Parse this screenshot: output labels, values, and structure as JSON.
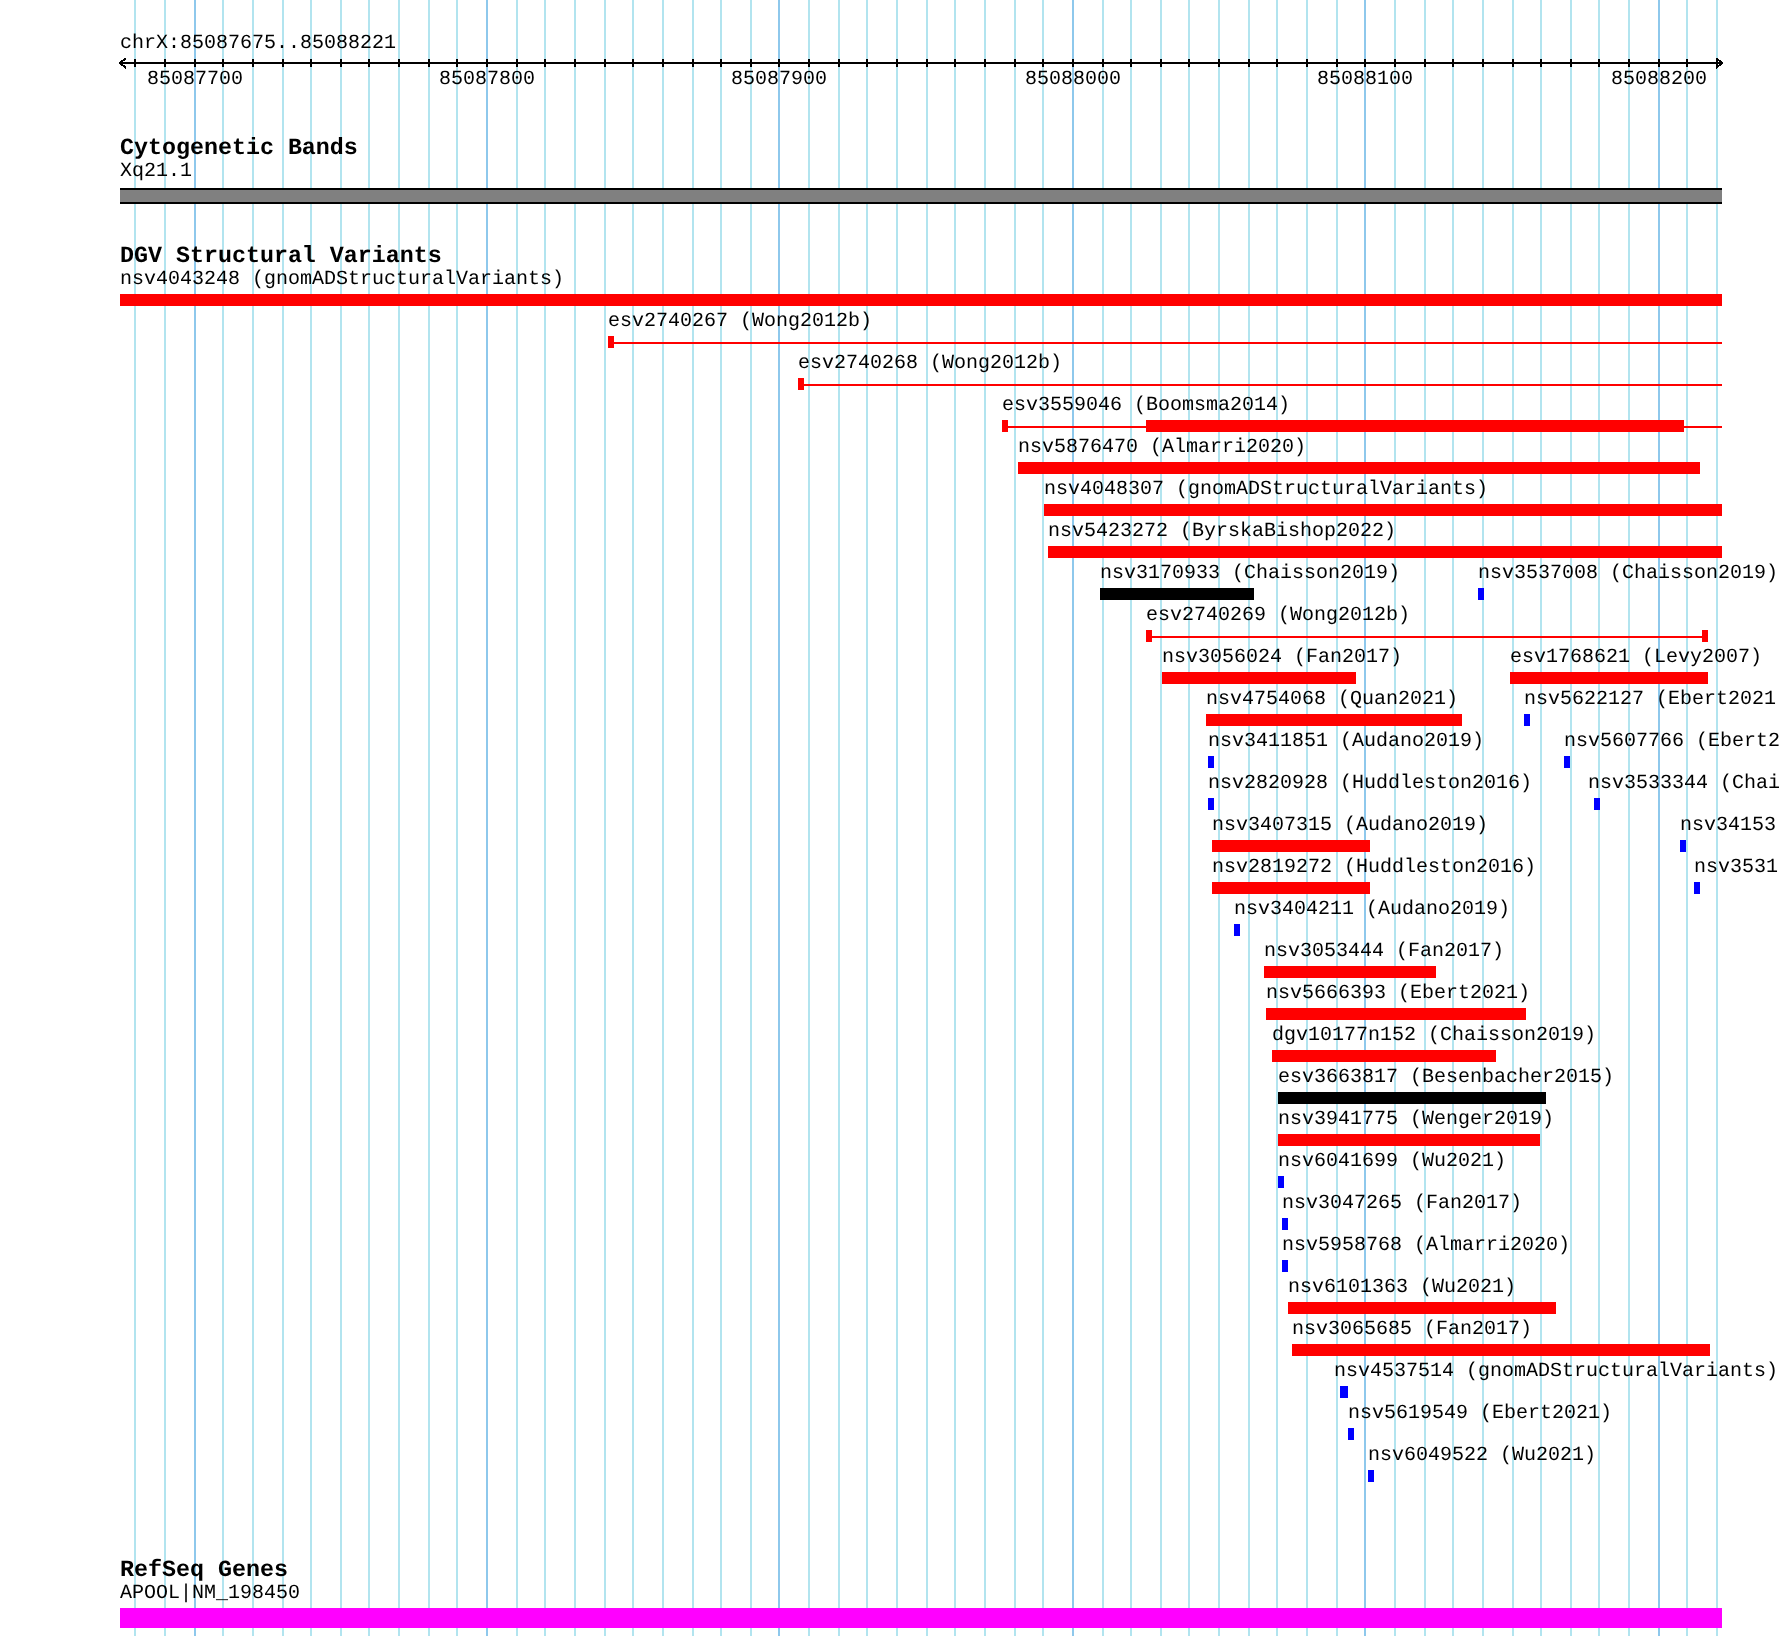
{
  "ruler": {
    "region": "chrX:85087675..85088221",
    "ticks": [
      "85087700",
      "85087800",
      "85087900",
      "85088000",
      "85088100",
      "85088200"
    ]
  },
  "tracks": [
    {
      "kind": "bands",
      "title": "Cytogenetic Bands",
      "features": [
        {
          "label": "Xq21.1"
        }
      ]
    },
    {
      "kind": "variants",
      "title": "DGV Structural Variants",
      "features": [
        {
          "label": "nsv4043248 (gnomADStructuralVariants)",
          "kind": "block",
          "color": "#ff0000"
        },
        {
          "label": "esv2740267 (Wong2012b)",
          "kind": "line",
          "color": "#ff0000"
        },
        {
          "label": "esv2740268 (Wong2012b)",
          "kind": "line",
          "color": "#ff0000"
        },
        {
          "label": "esv3559046 (Boomsma2014)",
          "kind": "line-block",
          "color": "#ff0000"
        },
        {
          "label": "nsv5876470 (Almarri2020)",
          "kind": "block",
          "color": "#ff0000"
        },
        {
          "label": "nsv4048307 (gnomADStructuralVariants)",
          "kind": "block",
          "color": "#ff0000"
        },
        {
          "label": "nsv5423272 (ByrskaBishop2022)",
          "kind": "block",
          "color": "#ff0000"
        },
        {
          "label": "nsv3170933 (Chaisson2019)",
          "kind": "block",
          "color": "#000000"
        },
        {
          "label": "nsv3537008 (Chaisson2019)",
          "kind": "block",
          "color": "#0000ff"
        },
        {
          "label": "esv2740269 (Wong2012b)",
          "kind": "line",
          "color": "#ff0000"
        },
        {
          "label": "nsv3056024 (Fan2017)",
          "kind": "block",
          "color": "#ff0000"
        },
        {
          "label": "esv1768621 (Levy2007)",
          "kind": "block",
          "color": "#ff0000"
        },
        {
          "label": "nsv4754068 (Quan2021)",
          "kind": "block",
          "color": "#ff0000"
        },
        {
          "label": "nsv5622127 (Ebert2021",
          "kind": "block",
          "color": "#0000ff"
        },
        {
          "label": "nsv3411851 (Audano2019)",
          "kind": "block",
          "color": "#0000ff"
        },
        {
          "label": "nsv5607766 (Ebert2",
          "kind": "block",
          "color": "#0000ff"
        },
        {
          "label": "nsv2820928 (Huddleston2016)",
          "kind": "block",
          "color": "#0000ff"
        },
        {
          "label": "nsv3533344 (Chai",
          "kind": "block",
          "color": "#0000ff"
        },
        {
          "label": "nsv3407315 (Audano2019)",
          "kind": "block",
          "color": "#ff0000"
        },
        {
          "label": "nsv34153",
          "kind": "block",
          "color": "#0000ff"
        },
        {
          "label": "nsv2819272 (Huddleston2016)",
          "kind": "block",
          "color": "#ff0000"
        },
        {
          "label": "nsv3531",
          "kind": "block",
          "color": "#0000ff"
        },
        {
          "label": "nsv3404211 (Audano2019)",
          "kind": "block",
          "color": "#0000ff"
        },
        {
          "label": "nsv3053444 (Fan2017)",
          "kind": "block",
          "color": "#ff0000"
        },
        {
          "label": "nsv5666393 (Ebert2021)",
          "kind": "block",
          "color": "#ff0000"
        },
        {
          "label": "dgv10177n152 (Chaisson2019)",
          "kind": "block",
          "color": "#ff0000"
        },
        {
          "label": "esv3663817 (Besenbacher2015)",
          "kind": "block",
          "color": "#000000"
        },
        {
          "label": "nsv3941775 (Wenger2019)",
          "kind": "block",
          "color": "#ff0000"
        },
        {
          "label": "nsv6041699 (Wu2021)",
          "kind": "block",
          "color": "#0000ff"
        },
        {
          "label": "nsv3047265 (Fan2017)",
          "kind": "block",
          "color": "#0000ff"
        },
        {
          "label": "nsv5958768 (Almarri2020)",
          "kind": "block",
          "color": "#0000ff"
        },
        {
          "label": "nsv6101363 (Wu2021)",
          "kind": "block",
          "color": "#ff0000"
        },
        {
          "label": "nsv3065685 (Fan2017)",
          "kind": "block",
          "color": "#ff0000"
        },
        {
          "label": "nsv4537514 (gnomADStructuralVariants)",
          "kind": "block",
          "color": "#0000ff"
        },
        {
          "label": "nsv5619549 (Ebert2021)",
          "kind": "block",
          "color": "#0000ff"
        },
        {
          "label": "nsv6049522 (Wu2021)",
          "kind": "block",
          "color": "#0000ff"
        }
      ]
    },
    {
      "kind": "genes",
      "title": "RefSeq Genes",
      "features": [
        {
          "label": "APOOL|NM_198450"
        }
      ]
    }
  ]
}
